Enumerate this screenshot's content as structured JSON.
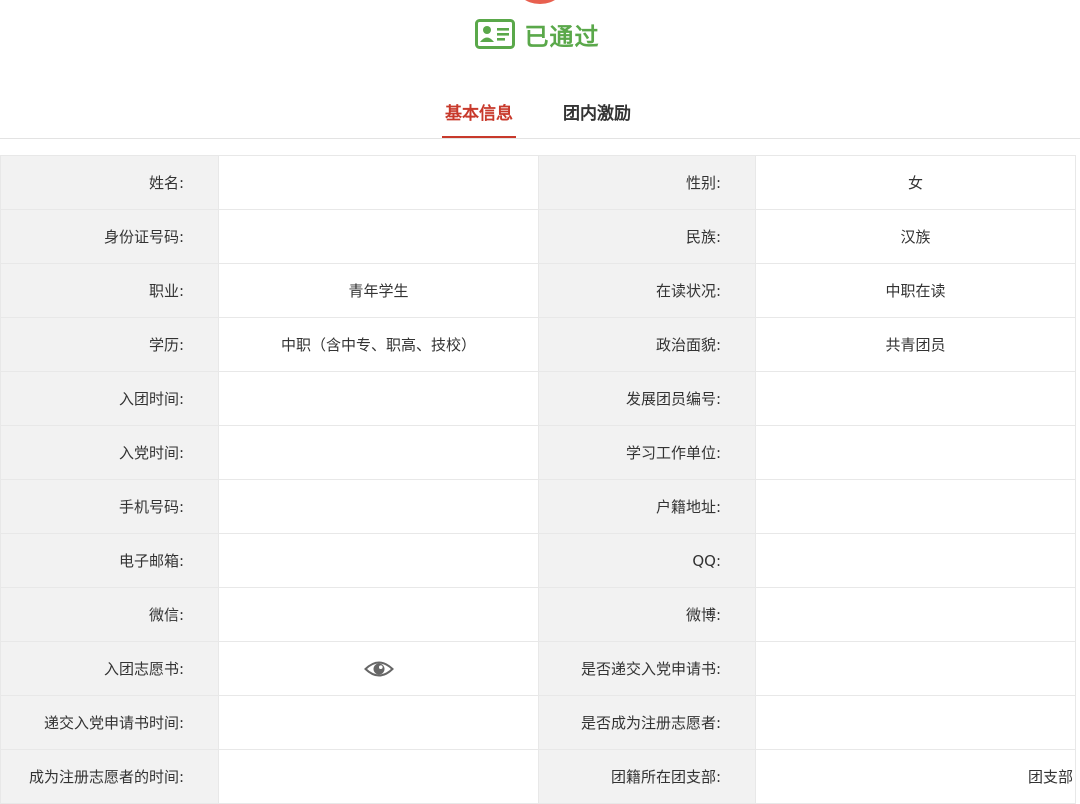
{
  "status": {
    "text": "已通过",
    "icon": "id-card-icon",
    "color": "#5aa84a"
  },
  "tabs": [
    {
      "label": "基本信息",
      "active": true
    },
    {
      "label": "团内激励",
      "active": false
    }
  ],
  "accent_color": "#c8392b",
  "rows": [
    {
      "label_left": "姓名:",
      "value_left": "",
      "label_right": "性别:",
      "value_right": "女"
    },
    {
      "label_left": "身份证号码:",
      "value_left": "",
      "label_right": "民族:",
      "value_right": "汉族"
    },
    {
      "label_left": "职业:",
      "value_left": "青年学生",
      "label_right": "在读状况:",
      "value_right": "中职在读"
    },
    {
      "label_left": "学历:",
      "value_left": "中职（含中专、职高、技校）",
      "label_right": "政治面貌:",
      "value_right": "共青团员"
    },
    {
      "label_left": "入团时间:",
      "value_left": "",
      "label_right": "发展团员编号:",
      "value_right": ""
    },
    {
      "label_left": "入党时间:",
      "value_left": "",
      "label_right": "学习工作单位:",
      "value_right": ""
    },
    {
      "label_left": "手机号码:",
      "value_left": "",
      "label_right": "户籍地址:",
      "value_right": ""
    },
    {
      "label_left": "电子邮箱:",
      "value_left": "",
      "label_right": "QQ:",
      "value_right": ""
    },
    {
      "label_left": "微信:",
      "value_left": "",
      "label_right": "微博:",
      "value_right": ""
    },
    {
      "label_left": "入团志愿书:",
      "value_left_icon": "eye-icon",
      "label_right": "是否递交入党申请书:",
      "value_right": ""
    },
    {
      "label_left": "递交入党申请书时间:",
      "value_left": "",
      "label_right": "是否成为注册志愿者:",
      "value_right": ""
    },
    {
      "label_left": "成为注册志愿者的时间:",
      "value_left": "",
      "label_right": "团籍所在团支部:",
      "value_right": "团支部"
    }
  ]
}
